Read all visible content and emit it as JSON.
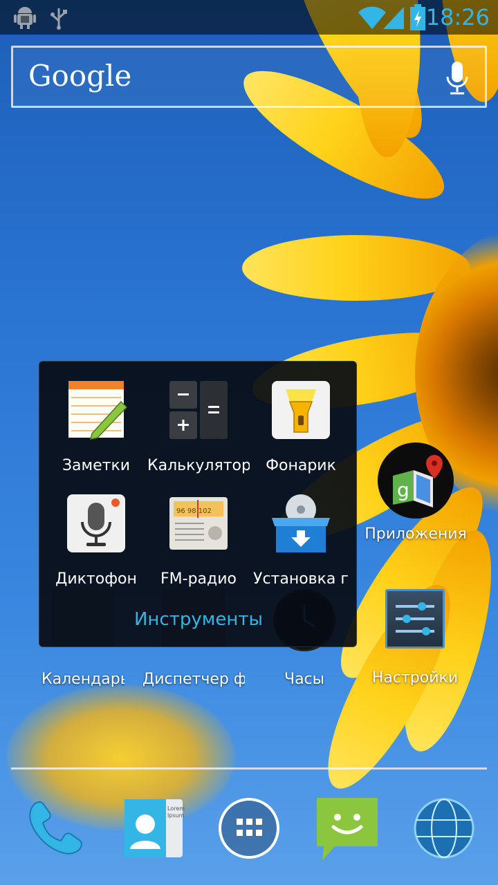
{
  "statusbar": {
    "time": "18:26",
    "icons": [
      "android-debug-icon",
      "usb-icon",
      "wifi-icon",
      "signal-icon",
      "battery-charging-icon"
    ]
  },
  "search": {
    "logo": "Google",
    "mic_icon": "microphone-icon"
  },
  "folder": {
    "name": "Инструменты",
    "items": [
      {
        "label": "Заметки",
        "icon": "notes-icon"
      },
      {
        "label": "Калькулятор",
        "icon": "calculator-icon"
      },
      {
        "label": "Фонарик",
        "icon": "flashlight-icon"
      },
      {
        "label": "Диктофон",
        "icon": "voice-recorder-icon"
      },
      {
        "label": "FM-радио",
        "icon": "fm-radio-icon"
      },
      {
        "label": "Установка г",
        "icon": "installer-icon"
      }
    ]
  },
  "home": {
    "items": [
      {
        "label": "Приложения",
        "icon": "google-maps-folder-icon"
      },
      {
        "label": "Календарь",
        "icon": "calendar-icon"
      },
      {
        "label": "Диспетчер ф",
        "icon": "file-manager-icon"
      },
      {
        "label": "Часы",
        "icon": "clock-icon"
      },
      {
        "label": "Настройки",
        "icon": "settings-icon"
      }
    ]
  },
  "dock": {
    "items": [
      "phone-icon",
      "contacts-icon",
      "all-apps-icon",
      "messaging-icon",
      "browser-icon"
    ]
  },
  "colors": {
    "accent": "#33b5e5",
    "folder_bg": "#080c14"
  }
}
